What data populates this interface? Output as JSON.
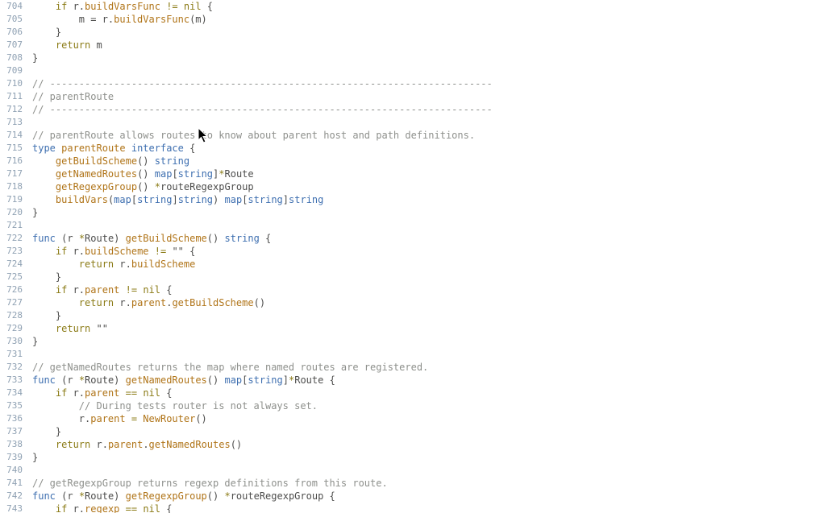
{
  "editor": {
    "lines": [
      {
        "n": "704",
        "tokens": [
          [
            "    ",
            "t-punc"
          ],
          [
            "if",
            "t-kw"
          ],
          [
            " r.",
            "t-id"
          ],
          [
            "buildVarsFunc",
            "t-fn"
          ],
          [
            " != ",
            "t-op"
          ],
          [
            "nil",
            "t-kw"
          ],
          [
            " {",
            "t-punc"
          ]
        ]
      },
      {
        "n": "705",
        "tokens": [
          [
            "        m = r.",
            "t-id"
          ],
          [
            "buildVarsFunc",
            "t-fn"
          ],
          [
            "(m)",
            "t-punc"
          ]
        ]
      },
      {
        "n": "706",
        "tokens": [
          [
            "    }",
            "t-punc"
          ]
        ]
      },
      {
        "n": "707",
        "tokens": [
          [
            "    ",
            "t-punc"
          ],
          [
            "return",
            "t-kw"
          ],
          [
            " m",
            "t-id"
          ]
        ]
      },
      {
        "n": "708",
        "tokens": [
          [
            "}",
            "t-punc"
          ]
        ]
      },
      {
        "n": "709",
        "tokens": []
      },
      {
        "n": "710",
        "tokens": [
          [
            "// ----------------------------------------------------------------------------",
            "t-cmt"
          ]
        ]
      },
      {
        "n": "711",
        "tokens": [
          [
            "// parentRoute",
            "t-cmt"
          ]
        ]
      },
      {
        "n": "712",
        "tokens": [
          [
            "// ----------------------------------------------------------------------------",
            "t-cmt"
          ]
        ]
      },
      {
        "n": "713",
        "tokens": []
      },
      {
        "n": "714",
        "tokens": [
          [
            "// parentRoute allows routes to know about parent host and path definitions.",
            "t-cmt"
          ]
        ]
      },
      {
        "n": "715",
        "tokens": [
          [
            "type",
            "t-type"
          ],
          [
            " ",
            "t-punc"
          ],
          [
            "parentRoute",
            "t-fn"
          ],
          [
            " ",
            "t-punc"
          ],
          [
            "interface",
            "t-type"
          ],
          [
            " {",
            "t-punc"
          ]
        ]
      },
      {
        "n": "716",
        "tokens": [
          [
            "    ",
            "t-punc"
          ],
          [
            "getBuildScheme",
            "t-fn"
          ],
          [
            "() ",
            "t-punc"
          ],
          [
            "string",
            "t-type"
          ]
        ]
      },
      {
        "n": "717",
        "tokens": [
          [
            "    ",
            "t-punc"
          ],
          [
            "getNamedRoutes",
            "t-fn"
          ],
          [
            "() ",
            "t-punc"
          ],
          [
            "map",
            "t-type"
          ],
          [
            "[",
            "t-punc"
          ],
          [
            "string",
            "t-type"
          ],
          [
            "]",
            "t-punc"
          ],
          [
            "*",
            "t-op"
          ],
          [
            "Route",
            "t-id"
          ]
        ]
      },
      {
        "n": "718",
        "tokens": [
          [
            "    ",
            "t-punc"
          ],
          [
            "getRegexpGroup",
            "t-fn"
          ],
          [
            "() ",
            "t-punc"
          ],
          [
            "*",
            "t-op"
          ],
          [
            "routeRegexpGroup",
            "t-id"
          ]
        ]
      },
      {
        "n": "719",
        "tokens": [
          [
            "    ",
            "t-punc"
          ],
          [
            "buildVars",
            "t-fn"
          ],
          [
            "(",
            "t-punc"
          ],
          [
            "map",
            "t-type"
          ],
          [
            "[",
            "t-punc"
          ],
          [
            "string",
            "t-type"
          ],
          [
            "]",
            "t-punc"
          ],
          [
            "string",
            "t-type"
          ],
          [
            ") ",
            "t-punc"
          ],
          [
            "map",
            "t-type"
          ],
          [
            "[",
            "t-punc"
          ],
          [
            "string",
            "t-type"
          ],
          [
            "]",
            "t-punc"
          ],
          [
            "string",
            "t-type"
          ]
        ]
      },
      {
        "n": "720",
        "tokens": [
          [
            "}",
            "t-punc"
          ]
        ]
      },
      {
        "n": "721",
        "tokens": []
      },
      {
        "n": "722",
        "tokens": [
          [
            "func",
            "t-type"
          ],
          [
            " (r ",
            "t-punc"
          ],
          [
            "*",
            "t-op"
          ],
          [
            "Route) ",
            "t-id"
          ],
          [
            "getBuildScheme",
            "t-fn"
          ],
          [
            "() ",
            "t-punc"
          ],
          [
            "string",
            "t-type"
          ],
          [
            " {",
            "t-punc"
          ]
        ]
      },
      {
        "n": "723",
        "tokens": [
          [
            "    ",
            "t-punc"
          ],
          [
            "if",
            "t-kw"
          ],
          [
            " r.",
            "t-id"
          ],
          [
            "buildScheme",
            "t-fn"
          ],
          [
            " != ",
            "t-op"
          ],
          [
            "\"\"",
            "t-str"
          ],
          [
            " {",
            "t-punc"
          ]
        ]
      },
      {
        "n": "724",
        "tokens": [
          [
            "        ",
            "t-punc"
          ],
          [
            "return",
            "t-kw"
          ],
          [
            " r.",
            "t-id"
          ],
          [
            "buildScheme",
            "t-fn"
          ]
        ]
      },
      {
        "n": "725",
        "tokens": [
          [
            "    }",
            "t-punc"
          ]
        ]
      },
      {
        "n": "726",
        "tokens": [
          [
            "    ",
            "t-punc"
          ],
          [
            "if",
            "t-kw"
          ],
          [
            " r.",
            "t-id"
          ],
          [
            "parent",
            "t-fn"
          ],
          [
            " != ",
            "t-op"
          ],
          [
            "nil",
            "t-kw"
          ],
          [
            " {",
            "t-punc"
          ]
        ]
      },
      {
        "n": "727",
        "tokens": [
          [
            "        ",
            "t-punc"
          ],
          [
            "return",
            "t-kw"
          ],
          [
            " r.",
            "t-id"
          ],
          [
            "parent",
            "t-fn"
          ],
          [
            ".",
            "t-punc"
          ],
          [
            "getBuildScheme",
            "t-fn"
          ],
          [
            "()",
            "t-punc"
          ]
        ]
      },
      {
        "n": "728",
        "tokens": [
          [
            "    }",
            "t-punc"
          ]
        ]
      },
      {
        "n": "729",
        "tokens": [
          [
            "    ",
            "t-punc"
          ],
          [
            "return",
            "t-kw"
          ],
          [
            " ",
            "t-punc"
          ],
          [
            "\"\"",
            "t-str"
          ]
        ]
      },
      {
        "n": "730",
        "tokens": [
          [
            "}",
            "t-punc"
          ]
        ]
      },
      {
        "n": "731",
        "tokens": []
      },
      {
        "n": "732",
        "tokens": [
          [
            "// getNamedRoutes returns the map where named routes are registered.",
            "t-cmt"
          ]
        ]
      },
      {
        "n": "733",
        "tokens": [
          [
            "func",
            "t-type"
          ],
          [
            " (r ",
            "t-punc"
          ],
          [
            "*",
            "t-op"
          ],
          [
            "Route) ",
            "t-id"
          ],
          [
            "getNamedRoutes",
            "t-fn"
          ],
          [
            "() ",
            "t-punc"
          ],
          [
            "map",
            "t-type"
          ],
          [
            "[",
            "t-punc"
          ],
          [
            "string",
            "t-type"
          ],
          [
            "]",
            "t-punc"
          ],
          [
            "*",
            "t-op"
          ],
          [
            "Route",
            "t-id"
          ],
          [
            " {",
            "t-punc"
          ]
        ]
      },
      {
        "n": "734",
        "tokens": [
          [
            "    ",
            "t-punc"
          ],
          [
            "if",
            "t-kw"
          ],
          [
            " r.",
            "t-id"
          ],
          [
            "parent",
            "t-fn"
          ],
          [
            " == ",
            "t-op"
          ],
          [
            "nil",
            "t-kw"
          ],
          [
            " {",
            "t-punc"
          ]
        ]
      },
      {
        "n": "735",
        "tokens": [
          [
            "        ",
            "t-punc"
          ],
          [
            "// During tests router is not always set.",
            "t-cmt"
          ]
        ]
      },
      {
        "n": "736",
        "tokens": [
          [
            "        r.",
            "t-id"
          ],
          [
            "parent",
            "t-fn"
          ],
          [
            " = ",
            "t-op"
          ],
          [
            "NewRouter",
            "t-fn"
          ],
          [
            "()",
            "t-punc"
          ]
        ]
      },
      {
        "n": "737",
        "tokens": [
          [
            "    }",
            "t-punc"
          ]
        ]
      },
      {
        "n": "738",
        "tokens": [
          [
            "    ",
            "t-punc"
          ],
          [
            "return",
            "t-kw"
          ],
          [
            " r.",
            "t-id"
          ],
          [
            "parent",
            "t-fn"
          ],
          [
            ".",
            "t-punc"
          ],
          [
            "getNamedRoutes",
            "t-fn"
          ],
          [
            "()",
            "t-punc"
          ]
        ]
      },
      {
        "n": "739",
        "tokens": [
          [
            "}",
            "t-punc"
          ]
        ]
      },
      {
        "n": "740",
        "tokens": []
      },
      {
        "n": "741",
        "tokens": [
          [
            "// getRegexpGroup returns regexp definitions from this route.",
            "t-cmt"
          ]
        ]
      },
      {
        "n": "742",
        "tokens": [
          [
            "func",
            "t-type"
          ],
          [
            " (r ",
            "t-punc"
          ],
          [
            "*",
            "t-op"
          ],
          [
            "Route) ",
            "t-id"
          ],
          [
            "getRegexpGroup",
            "t-fn"
          ],
          [
            "() ",
            "t-punc"
          ],
          [
            "*",
            "t-op"
          ],
          [
            "routeRegexpGroup",
            "t-id"
          ],
          [
            " {",
            "t-punc"
          ]
        ]
      },
      {
        "n": "743",
        "tokens": [
          [
            "    ",
            "t-punc"
          ],
          [
            "if",
            "t-kw"
          ],
          [
            " r.",
            "t-id"
          ],
          [
            "regexp",
            "t-fn"
          ],
          [
            " == ",
            "t-op"
          ],
          [
            "nil",
            "t-kw"
          ],
          [
            " {",
            "t-punc"
          ]
        ]
      }
    ]
  }
}
